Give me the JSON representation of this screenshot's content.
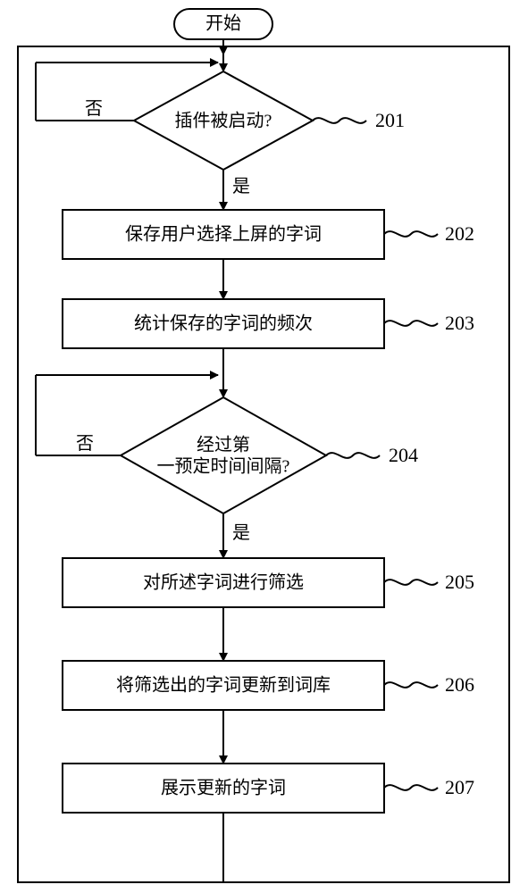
{
  "chart_data": {
    "type": "flowchart",
    "title": "",
    "nodes": [
      {
        "id": "start",
        "type": "terminator",
        "label": "开始"
      },
      {
        "id": "d201",
        "type": "decision",
        "label": "插件被启动?",
        "ref": "201"
      },
      {
        "id": "p202",
        "type": "process",
        "label": "保存用户选择上屏的字词",
        "ref": "202"
      },
      {
        "id": "p203",
        "type": "process",
        "label": "统计保存的字词的频次",
        "ref": "203"
      },
      {
        "id": "d204",
        "type": "decision",
        "label_lines": [
          "经过第",
          "一预定时间间隔?"
        ],
        "ref": "204"
      },
      {
        "id": "p205",
        "type": "process",
        "label": "对所述字词进行筛选",
        "ref": "205"
      },
      {
        "id": "p206",
        "type": "process",
        "label": "将筛选出的字词更新到词库",
        "ref": "206"
      },
      {
        "id": "p207",
        "type": "process",
        "label": "展示更新的字词",
        "ref": "207"
      }
    ],
    "edges": [
      {
        "from": "start",
        "to": "d201"
      },
      {
        "from": "d201",
        "to": "p202",
        "label": "是"
      },
      {
        "from": "d201",
        "to": "d201_loop",
        "label": "否"
      },
      {
        "from": "p202",
        "to": "p203"
      },
      {
        "from": "p203",
        "to": "d204"
      },
      {
        "from": "d204",
        "to": "p205",
        "label": "是"
      },
      {
        "from": "d204",
        "to": "d204_loop",
        "label": "否"
      },
      {
        "from": "p205",
        "to": "p206"
      },
      {
        "from": "p206",
        "to": "p207"
      },
      {
        "from": "p207",
        "to": "start_loop"
      }
    ],
    "labels": {
      "yes": "是",
      "no": "否"
    }
  },
  "start": "开始",
  "d201": "插件被启动?",
  "r201": "201",
  "yes1": "是",
  "no1": "否",
  "p202": "保存用户选择上屏的字词",
  "r202": "202",
  "p203": "统计保存的字词的频次",
  "r203": "203",
  "d204a": "经过第",
  "d204b": "一预定时间间隔?",
  "r204": "204",
  "yes2": "是",
  "no2": "否",
  "p205": "对所述字词进行筛选",
  "r205": "205",
  "p206": "将筛选出的字词更新到词库",
  "r206": "206",
  "p207": "展示更新的字词",
  "r207": "207"
}
